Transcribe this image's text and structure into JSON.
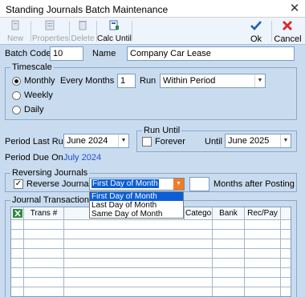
{
  "window": {
    "title": "Standing Journals Batch Maintenance",
    "close_glyph": "✕"
  },
  "toolbar": {
    "new_label": "New",
    "properties_label": "Properties",
    "delete_label": "Delete",
    "calc_until_label": "Calc Until",
    "ok_label": "Ok",
    "cancel_label": "Cancel"
  },
  "form": {
    "batch_code_label": "Batch Code",
    "batch_code_value": "10",
    "name_label": "Name",
    "name_value": "Company Car Lease"
  },
  "timescale": {
    "title": "Timescale",
    "monthly_label": "Monthly",
    "weekly_label": "Weekly",
    "daily_label": "Daily",
    "selected": "Monthly",
    "every_months_label": "Every Months",
    "every_months_value": "1",
    "run_label": "Run",
    "run_value": "Within Period"
  },
  "period": {
    "last_run_label": "Period Last Run",
    "last_run_value": "June 2024",
    "due_on_label": "Period Due On",
    "due_on_value": "July 2024"
  },
  "run_until": {
    "title": "Run Until",
    "forever_label": "Forever",
    "forever_checked": false,
    "until_label": "Until",
    "until_value": "June 2025"
  },
  "reversing": {
    "title": "Reversing Journals",
    "reverse_label": "Reverse Journals",
    "reverse_checked": true,
    "check_glyph": "✓",
    "mode_value": "First Day of Month",
    "months_value": "",
    "months_after_label": "Months after Posting",
    "options": [
      "First Day of Month",
      "Last Day of Month",
      "Same Day of Month"
    ]
  },
  "transactions": {
    "title": "Journal Transactions",
    "columns": [
      "Trans #",
      "Category",
      "Bank",
      "Rec/Pay"
    ]
  },
  "colors": {
    "accent": "#0b5fd6",
    "due_text": "#1f4fd0",
    "combo_button": "#f47b20",
    "check_green": "#2e8b3e",
    "cancel_red": "#d9262c"
  },
  "icons": [
    "new-icon",
    "properties-icon",
    "delete-icon",
    "calc-until-icon",
    "ok-check-icon",
    "cancel-x-icon",
    "excel-icon",
    "chevron-down-icon"
  ]
}
